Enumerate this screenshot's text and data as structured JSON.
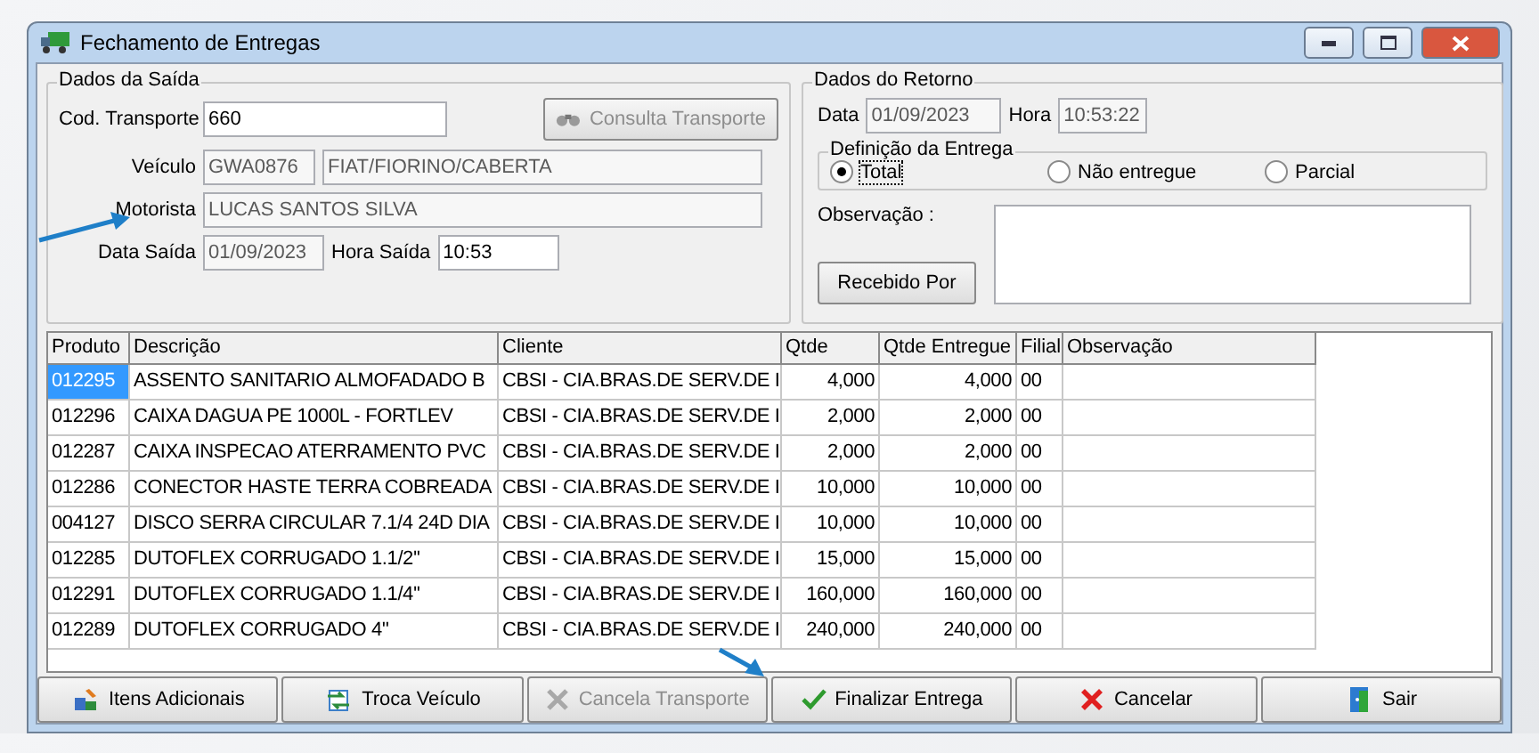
{
  "window": {
    "title": "Fechamento de Entregas"
  },
  "dados_saida": {
    "title": "Dados da Saída",
    "cod_transporte": {
      "label": "Cod. Transporte",
      "value": "660",
      "disabled": false
    },
    "consulta_button": {
      "label": "Consulta Transporte",
      "disabled": true
    },
    "veiculo": {
      "label": "Veículo",
      "plate": "GWA0876",
      "model": "FIAT/FIORINO/CABERTA",
      "disabled": true
    },
    "motorista": {
      "label": "Motorista",
      "value": "LUCAS SANTOS SILVA",
      "disabled": true
    },
    "data_saida": {
      "label": "Data Saída",
      "value": "01/09/2023",
      "disabled": true
    },
    "hora_saida": {
      "label": "Hora Saída",
      "value": "10:53",
      "disabled": false
    }
  },
  "dados_retorno": {
    "title": "Dados do Retorno",
    "data": {
      "label": "Data",
      "value": "01/09/2023",
      "disabled": true
    },
    "hora": {
      "label": "Hora",
      "value": "10:53:22",
      "disabled": true
    },
    "definicao": {
      "title": "Definição da Entrega",
      "options": [
        {
          "label": "Total",
          "selected": true
        },
        {
          "label": "Não entregue",
          "selected": false
        },
        {
          "label": "Parcial",
          "selected": false
        }
      ]
    },
    "observacao": {
      "label": "Observação :"
    },
    "recebido_button": {
      "label": "Recebido Por"
    }
  },
  "table": {
    "columns": [
      {
        "label": "Produto"
      },
      {
        "label": "Descrição"
      },
      {
        "label": "Cliente"
      },
      {
        "label": "Qtde"
      },
      {
        "label": "Qtde Entregue"
      },
      {
        "label": "Filial"
      },
      {
        "label": "Observação"
      }
    ],
    "rows": [
      {
        "selected": true,
        "cells": [
          "012295",
          "ASSENTO SANITARIO ALMOFADADO B",
          "CBSI - CIA.BRAS.DE SERV.DE I",
          "4,000",
          "4,000",
          "00",
          ""
        ]
      },
      {
        "selected": false,
        "cells": [
          "012296",
          "CAIXA DAGUA PE 1000L - FORTLEV",
          "CBSI - CIA.BRAS.DE SERV.DE I",
          "2,000",
          "2,000",
          "00",
          ""
        ]
      },
      {
        "selected": false,
        "cells": [
          "012287",
          "CAIXA INSPECAO ATERRAMENTO PVC",
          "CBSI - CIA.BRAS.DE SERV.DE I",
          "2,000",
          "2,000",
          "00",
          ""
        ]
      },
      {
        "selected": false,
        "cells": [
          "012286",
          "CONECTOR HASTE TERRA COBREADA",
          "CBSI - CIA.BRAS.DE SERV.DE I",
          "10,000",
          "10,000",
          "00",
          ""
        ]
      },
      {
        "selected": false,
        "cells": [
          "004127",
          "DISCO SERRA CIRCULAR 7.1/4 24D DIA",
          "CBSI - CIA.BRAS.DE SERV.DE I",
          "10,000",
          "10,000",
          "00",
          ""
        ]
      },
      {
        "selected": false,
        "cells": [
          "012285",
          "DUTOFLEX CORRUGADO 1.1/2''",
          "CBSI - CIA.BRAS.DE SERV.DE I",
          "15,000",
          "15,000",
          "00",
          ""
        ]
      },
      {
        "selected": false,
        "cells": [
          "012291",
          "DUTOFLEX CORRUGADO 1.1/4''",
          "CBSI - CIA.BRAS.DE SERV.DE I",
          "160,000",
          "160,000",
          "00",
          ""
        ]
      },
      {
        "selected": false,
        "cells": [
          "012289",
          "DUTOFLEX CORRUGADO 4''",
          "CBSI - CIA.BRAS.DE SERV.DE I",
          "240,000",
          "240,000",
          "00",
          ""
        ]
      }
    ]
  },
  "buttons": [
    {
      "label": "Itens Adicionais",
      "kind": "additional",
      "disabled": false
    },
    {
      "label": "Troca Veículo",
      "kind": "swap",
      "disabled": false
    },
    {
      "label": "Cancela Transporte",
      "kind": "cancel-transport",
      "disabled": true
    },
    {
      "label": "Finalizar Entrega",
      "kind": "finalize",
      "disabled": false
    },
    {
      "label": "Cancelar",
      "kind": "cancel",
      "disabled": false
    },
    {
      "label": "Sair",
      "kind": "exit",
      "disabled": false
    }
  ]
}
